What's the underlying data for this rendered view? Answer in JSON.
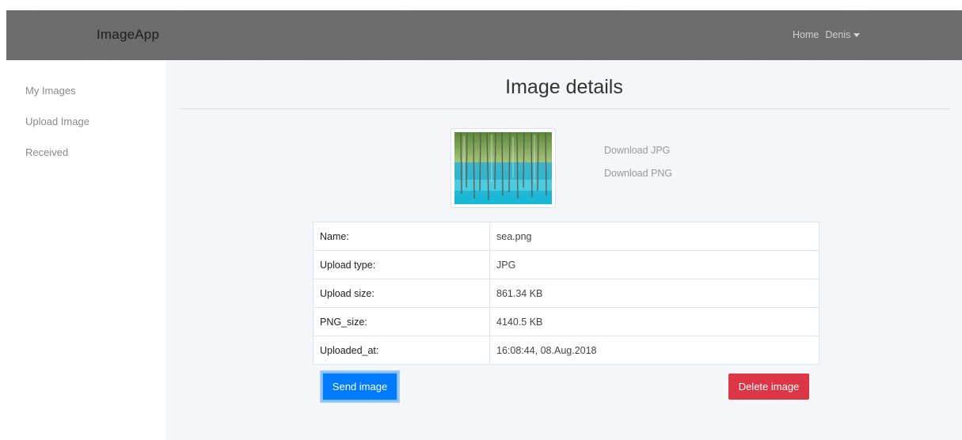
{
  "navbar": {
    "brand": "ImageApp",
    "home_label": "Home",
    "user_label": "Denis"
  },
  "sidebar": {
    "items": [
      {
        "label": "My Images"
      },
      {
        "label": "Upload Image"
      },
      {
        "label": "Received"
      }
    ]
  },
  "main": {
    "title": "Image details",
    "downloads": [
      {
        "label": "Download JPG"
      },
      {
        "label": "Download PNG"
      }
    ],
    "details": [
      {
        "key": "Name:",
        "value": "sea.png"
      },
      {
        "key": "Upload type:",
        "value": "JPG"
      },
      {
        "key": "Upload size:",
        "value": "861.34 KB"
      },
      {
        "key": "PNG_size:",
        "value": "4140.5 KB"
      },
      {
        "key": "Uploaded_at:",
        "value": "16:08:44, 08.Aug.2018"
      }
    ],
    "send_label": "Send image",
    "delete_label": "Delete image"
  },
  "colors": {
    "navbar": "#6e6e6e",
    "content_bg": "#f4f6f9",
    "primary": "#007bff",
    "danger": "#dc3545"
  },
  "icons": [
    "caret-down-icon"
  ]
}
